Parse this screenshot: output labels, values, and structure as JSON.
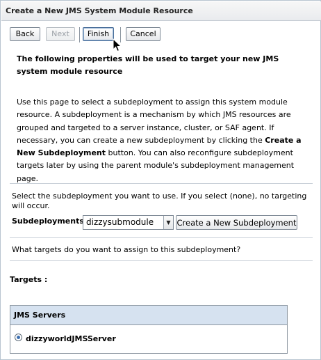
{
  "window": {
    "title": "Create a New JMS System Module Resource"
  },
  "toolbar": {
    "back_label": "Back",
    "next_label": "Next",
    "finish_label": "Finish",
    "cancel_label": "Cancel"
  },
  "heading": "The following properties will be used to target your new JMS system module resource",
  "description": {
    "part1": "Use this page to select a subdeployment to assign this system module resource. A subdeployment is a mechanism by which JMS resources are grouped and targeted to a server instance, cluster, or SAF agent. If necessary, you can create a new subdeployment by clicking the ",
    "bold": "Create a New Subdeployment",
    "part2": " button. You can also reconfigure subdeployment targets later by using the parent module's subdeployment management page."
  },
  "select_instruction": "Select the subdeployment you want to use. If you select (none), no targeting will occur.",
  "subdeployments": {
    "label": "Subdeployments:",
    "selected": "dizzysubmodule",
    "create_button_label": "Create a New Subdeployment"
  },
  "targets_question": "What targets do you want to assign to this subdeployment?",
  "targets_label": "Targets :",
  "jms_table": {
    "header": "JMS Servers",
    "rows": [
      {
        "name": "dizzyworldJMSServer",
        "selected": true
      }
    ]
  }
}
